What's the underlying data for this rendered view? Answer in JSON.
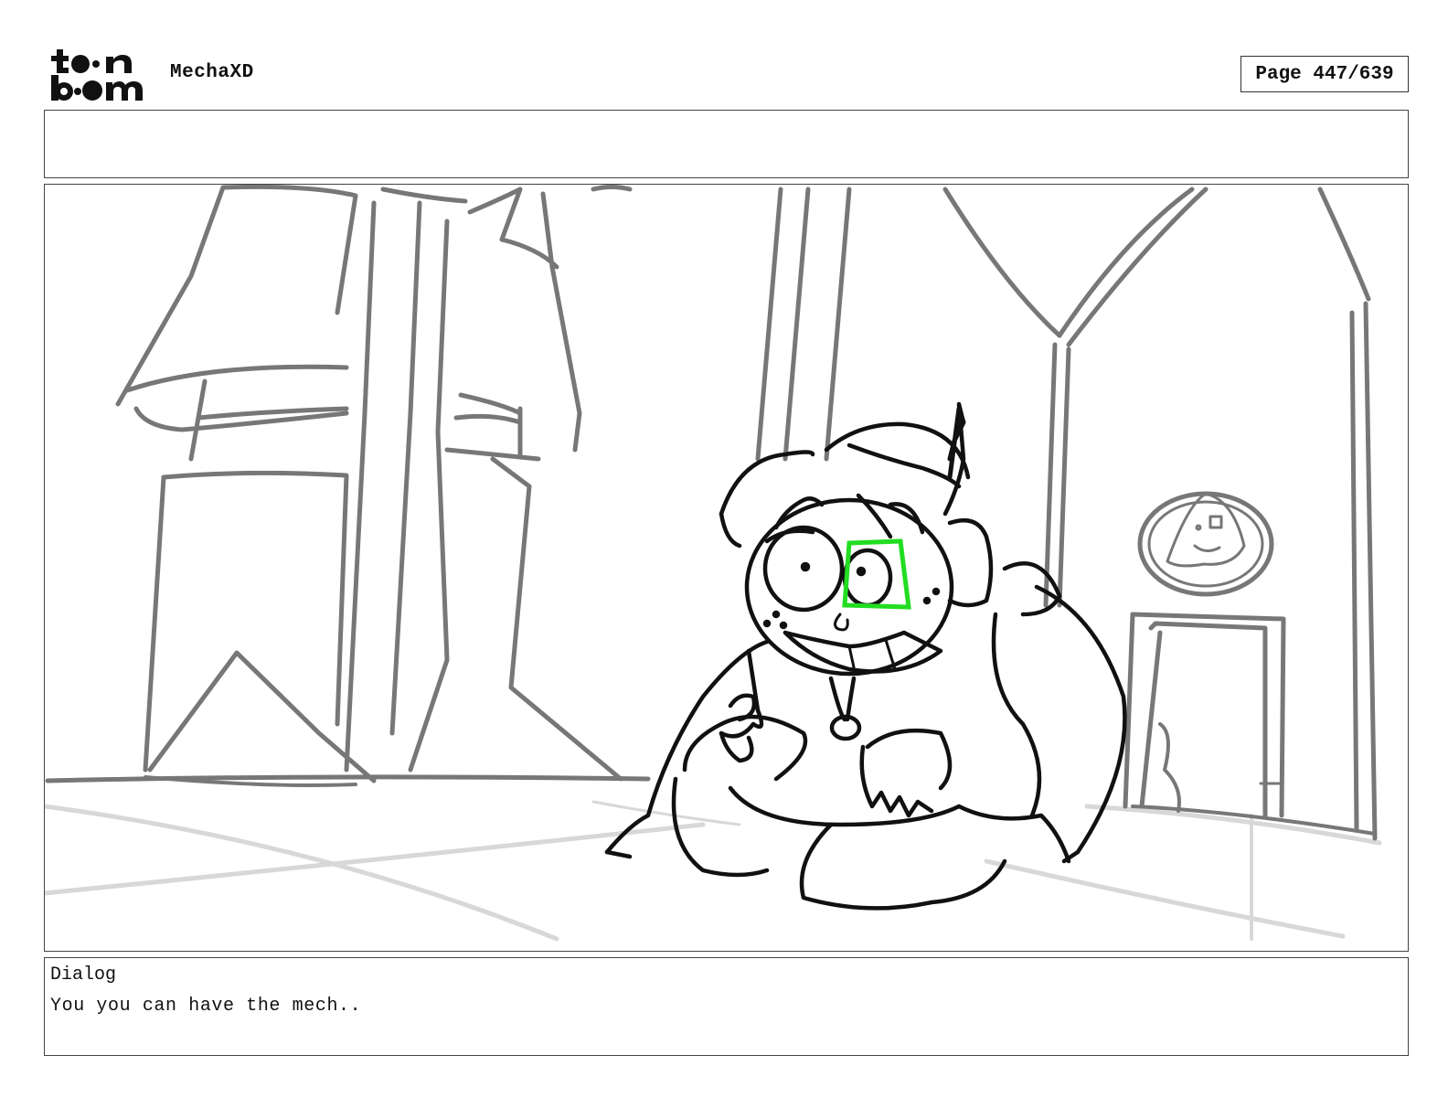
{
  "header": {
    "logo_alt": "toon boom",
    "project_name": "MechaXD",
    "page_label": "Page 447/639"
  },
  "panel": {
    "scene_description": ""
  },
  "dialog": {
    "label": "Dialog",
    "text": "You you can have the mech.."
  },
  "colors": {
    "sketch_gray": "#7a7a7a",
    "floor_light": "#d6d6d6",
    "ink": "#111111",
    "highlight_green": "#22dd22"
  }
}
